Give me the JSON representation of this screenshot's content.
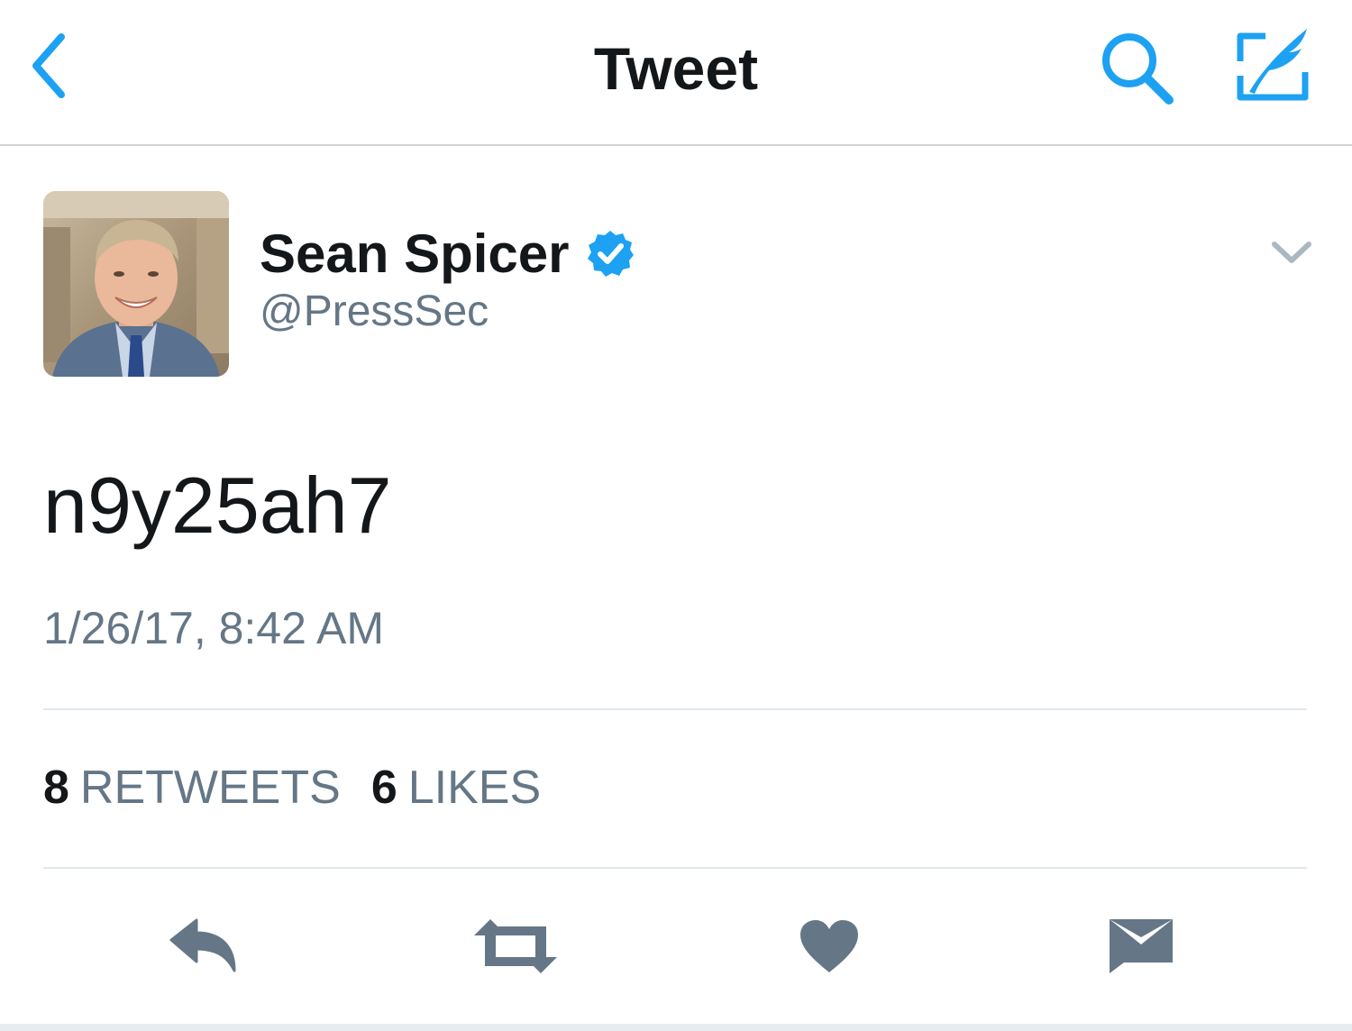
{
  "colors": {
    "accent": "#1da1f2",
    "text_primary": "#14171a",
    "text_secondary": "#657786",
    "action_icon": "#657786",
    "divider": "#e1e8ed"
  },
  "navbar": {
    "title": "Tweet",
    "back_icon": "chevron-left-icon",
    "search_icon": "search-icon",
    "compose_icon": "compose-tweet-icon"
  },
  "tweet": {
    "author": {
      "display_name": "Sean Spicer",
      "handle": "@PressSec",
      "verified": true,
      "avatar_icon": "profile-photo"
    },
    "text": "n9y25ah7",
    "timestamp": "1/26/17, 8:42 AM",
    "stats": {
      "retweets_count": "8",
      "retweets_label": "RETWEETS",
      "likes_count": "6",
      "likes_label": "LIKES"
    },
    "actions": [
      "reply-icon",
      "retweet-icon",
      "like-icon",
      "direct-message-icon"
    ]
  }
}
